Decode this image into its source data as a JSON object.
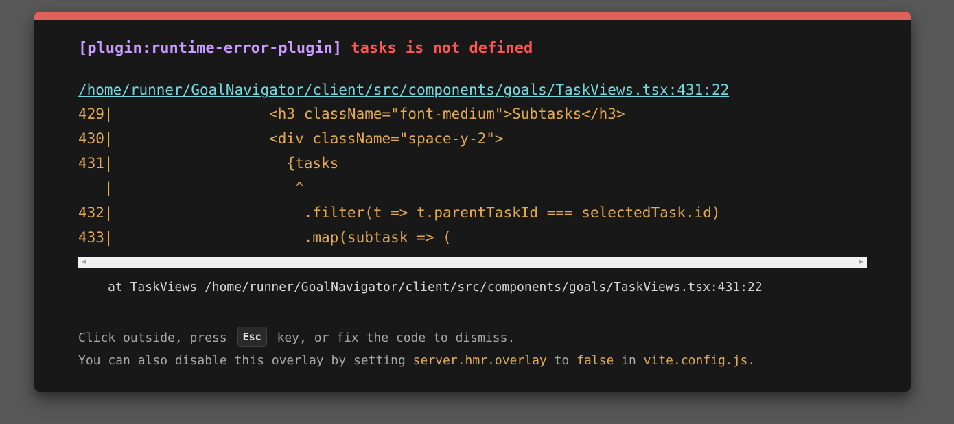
{
  "error": {
    "plugin": "[plugin:runtime-error-plugin]",
    "message": "tasks is not defined",
    "file": "/home/runner/GoalNavigator/client/src/components/goals/TaskViews.tsx:431:22"
  },
  "frame": [
    "429|                  <h3 className=\"font-medium\">Subtasks</h3>",
    "430|                  <div className=\"space-y-2\">",
    "431|                    {tasks",
    "   |                     ^",
    "432|                      .filter(t => t.parentTaskId === selectedTask.id)",
    "433|                      .map(subtask => ("
  ],
  "stack": {
    "prefix": "at TaskViews ",
    "file": "/home/runner/GoalNavigator/client/src/components/goals/TaskViews.tsx:431:22"
  },
  "tip": {
    "line1_before": "Click outside, press ",
    "esc_key": "Esc",
    "line1_after": " key, or fix the code to dismiss.",
    "line2_a": "You can also disable this overlay by setting ",
    "line2_code1": "server.hmr.overlay",
    "line2_b": " to ",
    "line2_code2": "false",
    "line2_c": " in ",
    "line2_code3": "vite.config.js",
    "line2_d": "."
  },
  "colors": {
    "accent_bar": "#e0605a",
    "plugin": "#c99aff",
    "error": "#ff5555",
    "link": "#77d7de",
    "code": "#e2aa53"
  }
}
